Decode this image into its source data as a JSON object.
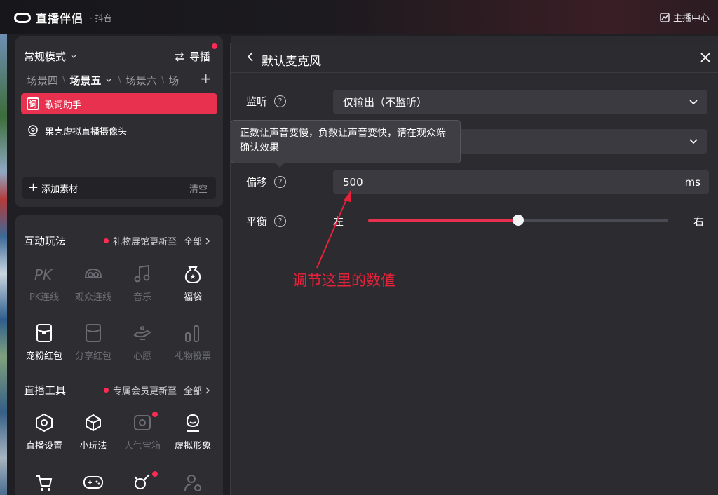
{
  "app": {
    "name": "直播伴侣",
    "platform": "· 抖音",
    "anchor_center": "主播中心"
  },
  "scene_panel": {
    "mode": "常规模式",
    "import": "导播",
    "tabs": [
      "场景四",
      "场景五",
      "场景六",
      "场"
    ],
    "active_tab_index": 1,
    "sources": [
      {
        "label": "歌词助手",
        "icon": "lyrics-icon",
        "icon_text": "词",
        "active": true
      },
      {
        "label": "果壳虚拟直播摄像头",
        "icon": "camera-icon",
        "active": false
      }
    ],
    "add_source": "添加素材",
    "clear": "清空"
  },
  "interactive": {
    "title": "互动玩法",
    "notice": "礼物展馆更新至",
    "all": "全部",
    "items": [
      {
        "label": "PK连线",
        "icon": "pk-icon",
        "enabled": false
      },
      {
        "label": "观众连线",
        "icon": "audience-link-icon",
        "enabled": false
      },
      {
        "label": "音乐",
        "icon": "music-icon",
        "enabled": false
      },
      {
        "label": "福袋",
        "icon": "lucky-bag-icon",
        "enabled": true
      },
      {
        "label": "宠粉红包",
        "icon": "red-packet-icon",
        "enabled": true
      },
      {
        "label": "分享红包",
        "icon": "share-packet-icon",
        "enabled": false
      },
      {
        "label": "心愿",
        "icon": "wish-lamp-icon",
        "enabled": false
      },
      {
        "label": "礼物投票",
        "icon": "gift-vote-icon",
        "enabled": false
      }
    ]
  },
  "live_tools": {
    "title": "直播工具",
    "notice": "专属会员更新至",
    "all": "全部",
    "items": [
      {
        "label": "直播设置",
        "icon": "live-settings-icon",
        "enabled": true
      },
      {
        "label": "小玩法",
        "icon": "mini-game-icon",
        "enabled": true
      },
      {
        "label": "人气宝箱",
        "icon": "treasure-box-icon",
        "enabled": false
      },
      {
        "label": "虚拟形象",
        "icon": "avatar-icon",
        "enabled": true
      }
    ]
  },
  "dialog": {
    "title": "默认麦克风",
    "monitor_label": "监听",
    "monitor_value": "仅输出（不监听）",
    "offset_label": "偏移",
    "offset_value": "500",
    "offset_unit": "ms",
    "balance_label": "平衡",
    "balance_left": "左",
    "balance_right": "右",
    "balance_level": 0.5,
    "tooltip": "正数让声音变慢，负数让声音变快，请在观众端确认效果"
  },
  "annotation": {
    "text": "调节这里的数值",
    "color": "#e8213a"
  },
  "colors": {
    "accent": "#e8314f",
    "notice_dot": "#fe2c55"
  }
}
